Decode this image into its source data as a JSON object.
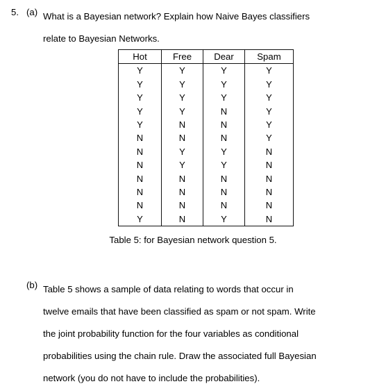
{
  "document": {
    "question_number": "5.",
    "parts": [
      {
        "letter": "(a)",
        "lines": [
          "What is a Bayesian network? Explain how Naive Bayes classifiers",
          "relate to Bayesian Networks."
        ]
      },
      {
        "letter": "(b)",
        "lines": [
          "Table 5 shows a sample of data relating to words that occur in",
          "twelve emails that have been classified as spam or not spam. Write",
          "the joint probability function for the four variables as conditional",
          "probabilities using the chain rule. Draw the associated full Bayesian",
          "network (you do not have to include the probabilities)."
        ]
      }
    ],
    "table": {
      "caption": "Table 5: for Bayesian network question 5.",
      "headers": [
        "Hot",
        "Free",
        "Dear",
        "Spam"
      ],
      "rows": [
        [
          "Y",
          "Y",
          "Y",
          "Y"
        ],
        [
          "Y",
          "Y",
          "Y",
          "Y"
        ],
        [
          "Y",
          "Y",
          "Y",
          "Y"
        ],
        [
          "Y",
          "Y",
          "N",
          "Y"
        ],
        [
          "Y",
          "N",
          "N",
          "Y"
        ],
        [
          "N",
          "N",
          "N",
          "Y"
        ],
        [
          "N",
          "Y",
          "Y",
          "N"
        ],
        [
          "N",
          "Y",
          "Y",
          "N"
        ],
        [
          "N",
          "N",
          "N",
          "N"
        ],
        [
          "N",
          "N",
          "N",
          "N"
        ],
        [
          "N",
          "N",
          "N",
          "N"
        ],
        [
          "Y",
          "N",
          "Y",
          "N"
        ]
      ]
    },
    "colors": {
      "text": "#000000",
      "background": "#ffffff",
      "table_border": "#111111"
    }
  }
}
